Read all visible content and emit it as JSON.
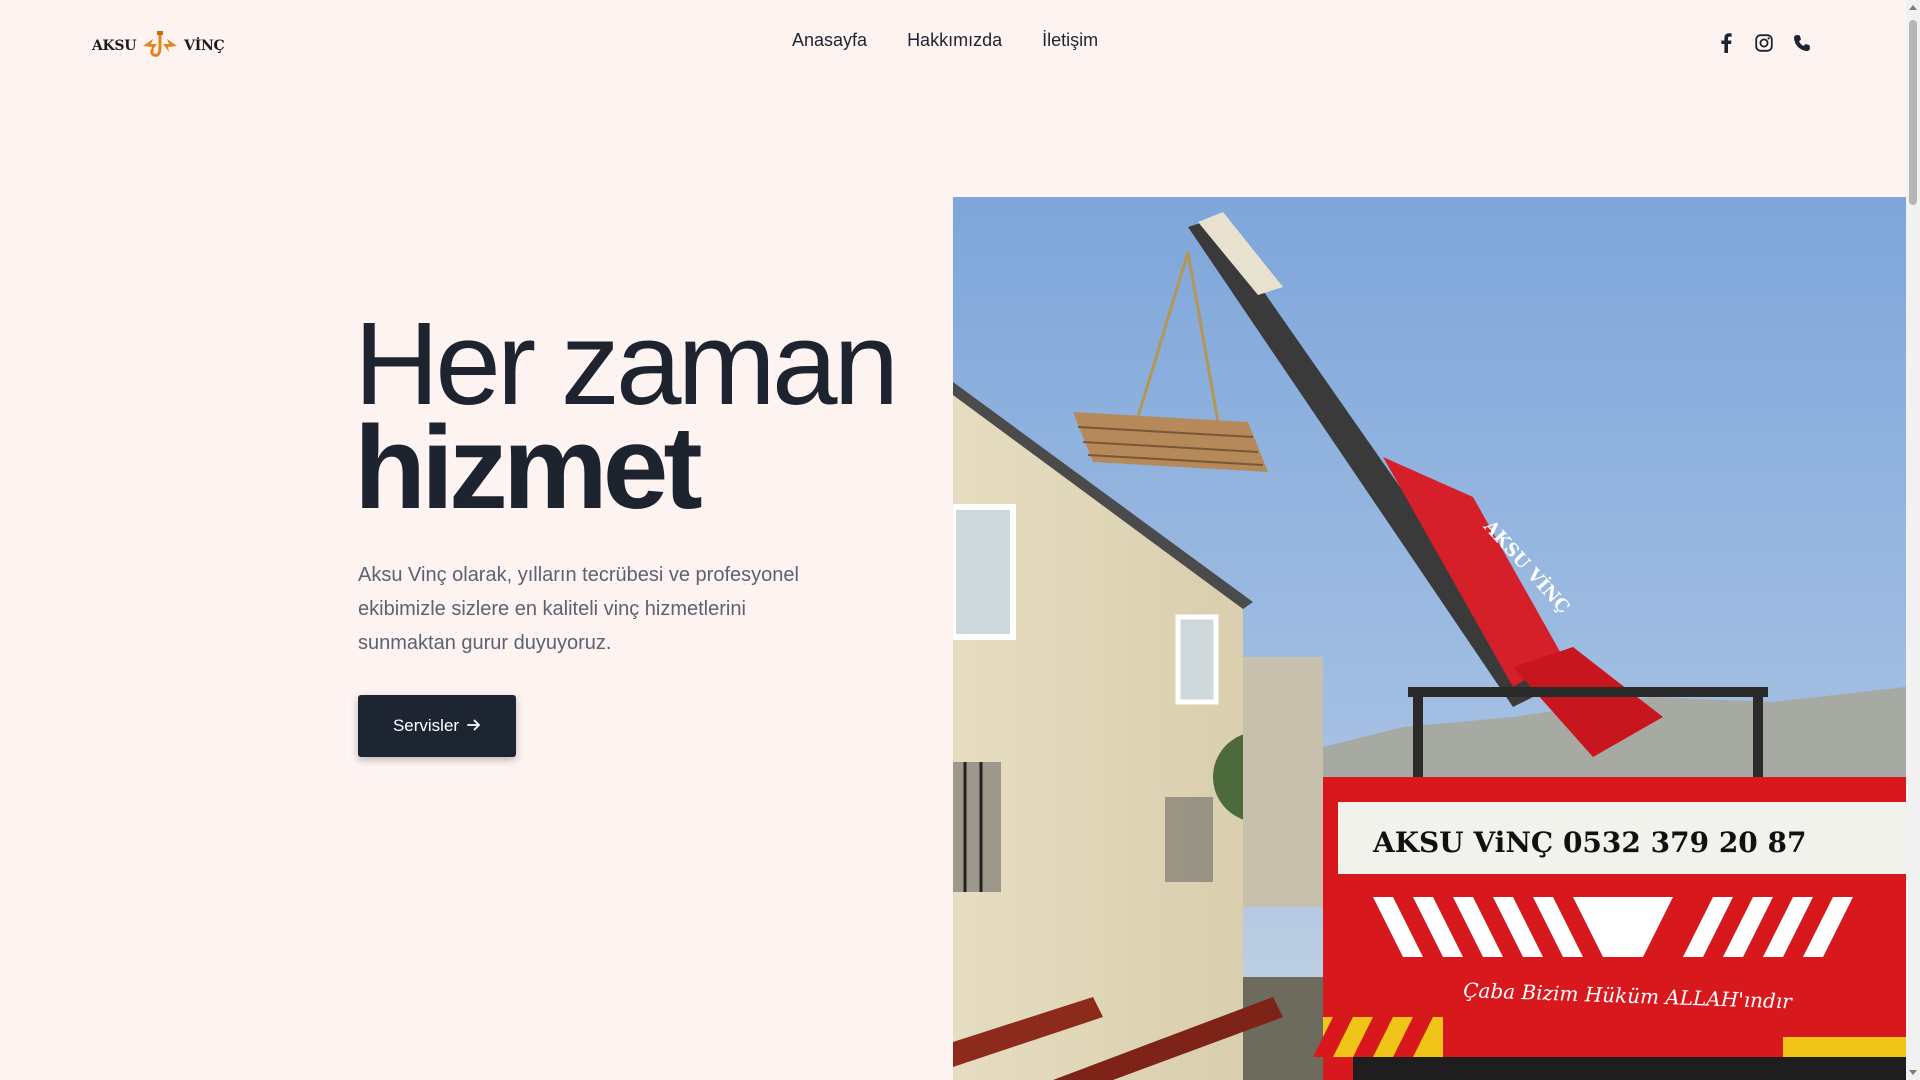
{
  "header": {
    "logo": {
      "left_word": "AKSU",
      "right_word": "VİNÇ"
    },
    "nav": [
      {
        "label": "Anasayfa"
      },
      {
        "label": "Hakkımızda"
      },
      {
        "label": "İletişim"
      }
    ],
    "social_icons": [
      "facebook-icon",
      "instagram-icon",
      "phone-icon"
    ]
  },
  "hero": {
    "title_line1": "Her zaman",
    "title_line2": "hizmet",
    "description": "Aksu Vinç olarak, yılların tecrübesi ve profesyonel ekibimizle sizlere en kaliteli vinç hizmetlerini sunmaktan gurur duyuyoruz.",
    "cta_label": "Servisler",
    "cta_icon": "arrow-right-icon"
  },
  "photo": {
    "truck_sign": "AKSU ViNÇ  0532 379 20 87",
    "boom_label": "AKSU VİNÇ",
    "bumper_text": "Çaba Bizim Hüküm ALLAH'ındır"
  },
  "colors": {
    "background": "#fdf4f2",
    "text_dark": "#1e2330",
    "text_muted": "#5b6270",
    "button": "#1e2532",
    "logo_accent": "#e8821e",
    "truck_red": "#d7191e",
    "sky": "#8fb1dd"
  }
}
